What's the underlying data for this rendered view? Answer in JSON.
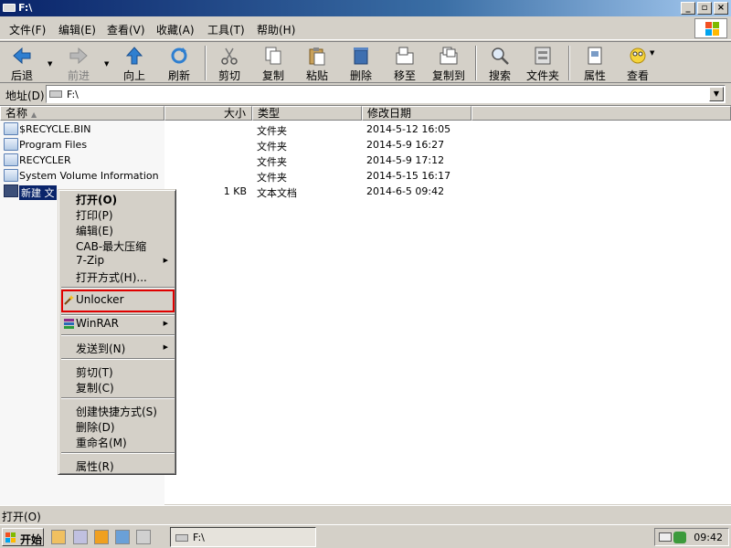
{
  "window": {
    "title": "F:\\"
  },
  "menubar": [
    "文件(F)",
    "编辑(E)",
    "查看(V)",
    "收藏(A)",
    "工具(T)",
    "帮助(H)"
  ],
  "toolbar": {
    "back": "后退",
    "forward": "前进",
    "up": "向上",
    "refresh": "刷新",
    "cut": "剪切",
    "copy": "复制",
    "paste": "粘贴",
    "delete": "删除",
    "move_to": "移至",
    "copy_to": "复制到",
    "search": "搜索",
    "folders": "文件夹",
    "properties": "属性",
    "view": "查看"
  },
  "address": {
    "label": "地址(D)",
    "value": "F:\\"
  },
  "columns": {
    "name": "名称",
    "size": "大小",
    "type": "类型",
    "modified": "修改日期"
  },
  "files": [
    {
      "name": "$RECYCLE.BIN",
      "size": "",
      "type": "文件夹",
      "modified": "2014-5-12 16:05",
      "kind": "folder"
    },
    {
      "name": "Program Files",
      "size": "",
      "type": "文件夹",
      "modified": "2014-5-9 16:27",
      "kind": "folder"
    },
    {
      "name": "RECYCLER",
      "size": "",
      "type": "文件夹",
      "modified": "2014-5-9 17:12",
      "kind": "folder"
    },
    {
      "name": "System Volume Information",
      "size": "",
      "type": "文件夹",
      "modified": "2014-5-15 16:17",
      "kind": "folder"
    },
    {
      "name": "新建 文",
      "size": "1 KB",
      "type": "文本文档",
      "modified": "2014-6-5 09:42",
      "kind": "text",
      "selected": true
    }
  ],
  "context_menu": {
    "open": "打开(O)",
    "print": "打印(P)",
    "edit": "编辑(E)",
    "cab": "CAB-最大压缩",
    "sevenzip": "7-Zip",
    "open_with": "打开方式(H)...",
    "unlocker": "Unlocker",
    "winrar": "WinRAR",
    "send_to": "发送到(N)",
    "cut": "剪切(T)",
    "copy": "复制(C)",
    "create_shortcut": "创建快捷方式(S)",
    "delete": "删除(D)",
    "rename": "重命名(M)",
    "properties": "属性(R)"
  },
  "status": {
    "text": "打开(O)"
  },
  "taskbar": {
    "start": "开始",
    "window": "F:\\",
    "clock": "09:42"
  },
  "colors": {
    "title_start": "#0a246a",
    "selection": "#0a246a",
    "highlight_box": "#e00000"
  }
}
